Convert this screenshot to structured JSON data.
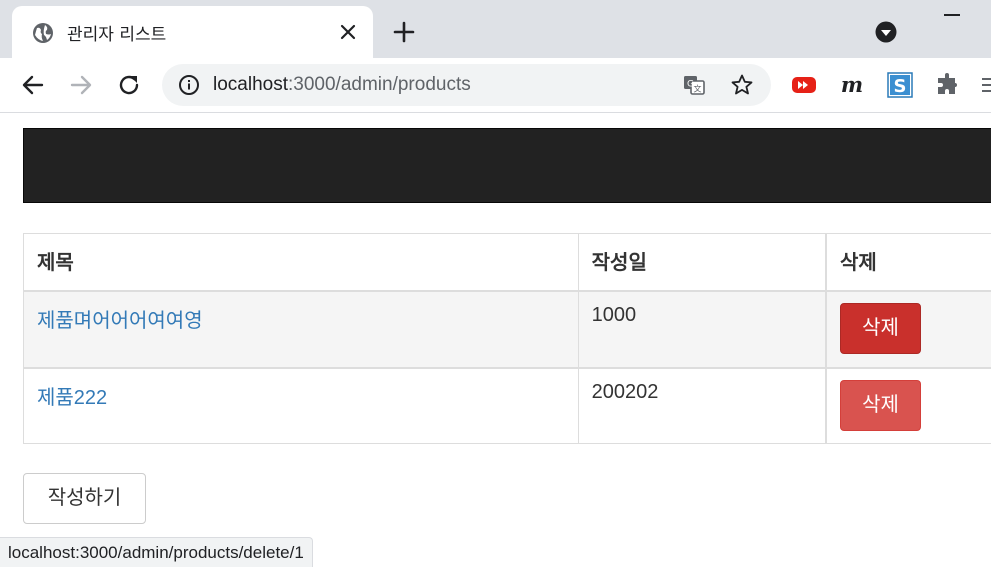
{
  "browser": {
    "tab_title": "관리자 리스트",
    "url_host": "localhost",
    "url_path": ":3000/admin/products",
    "status_url": "localhost:3000/admin/products/delete/1",
    "extensions": [
      "youtube-icon",
      "m-extension-icon",
      "s-extension-icon",
      "puzzle-icon"
    ]
  },
  "table": {
    "headers": [
      "제목",
      "작성일",
      "삭제"
    ],
    "rows": [
      {
        "title": "제품며어어어여여영",
        "date": "1000",
        "delete_label": "삭제"
      },
      {
        "title": "제품222",
        "date": "200202",
        "delete_label": "삭제"
      }
    ]
  },
  "actions": {
    "write_label": "작성하기"
  },
  "colors": {
    "navbar": "#222222",
    "link": "#337ab7",
    "danger": "#d9534f",
    "danger_hover": "#c9302c"
  }
}
